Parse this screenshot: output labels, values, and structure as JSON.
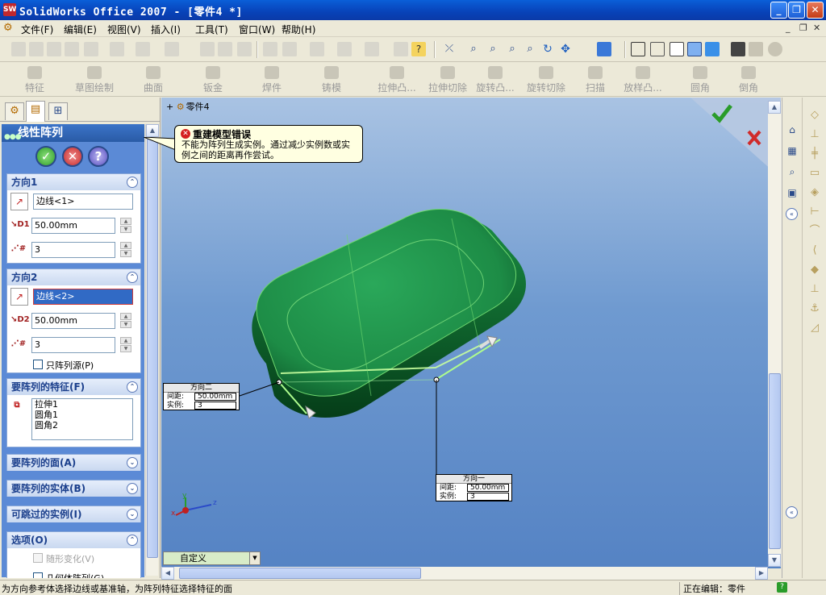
{
  "window": {
    "title": "SolidWorks Office 2007 - [零件4 *]",
    "app_icon": "solidworks-logo",
    "buttons": {
      "minimize": "_",
      "restore": "❐",
      "close": "✕"
    }
  },
  "menu": {
    "items": [
      "文件(F)",
      "编辑(E)",
      "视图(V)",
      "插入(I)",
      "工具(T)",
      "窗口(W)",
      "帮助(H)"
    ],
    "doc_controls": [
      "_",
      "❐",
      "✕"
    ]
  },
  "features_toolbar": {
    "items": [
      "特征",
      "草图绘制",
      "曲面",
      "钣金",
      "焊件",
      "铸模",
      "拉伸凸...",
      "拉伸切除",
      "旋转凸...",
      "旋转切除",
      "扫描",
      "放样凸...",
      "圆角",
      "倒角"
    ]
  },
  "property_manager": {
    "title": "线性阵列",
    "direction1": {
      "label": "方向1",
      "edge": "边线<1>",
      "spacing": "50.00mm",
      "instances": "3"
    },
    "direction2": {
      "label": "方向2",
      "edge": "边线<2>",
      "spacing": "50.00mm",
      "instances": "3",
      "pattern_seed_only": "只阵列源(P)"
    },
    "features_to_pattern": {
      "label": "要阵列的特征(F)",
      "items": [
        "拉伸1",
        "圆角1",
        "圆角2"
      ]
    },
    "faces_to_pattern": "要阵列的面(A)",
    "bodies_to_pattern": "要阵列的实体(B)",
    "instances_to_skip": "可跳过的实例(I)",
    "options": {
      "label": "选项(O)",
      "vary_sketch": "随形变化(V)",
      "geometry_pattern": "几何体阵列(G)"
    }
  },
  "tooltip": {
    "title": "重建模型错误",
    "message": "不能为阵列生成实例。通过减少实例数或实例之间的距离再作尝试。"
  },
  "viewport": {
    "tree_node": "零件4",
    "callout_dir2": {
      "title": "方向二",
      "spacing_label": "间距:",
      "spacing": "50.00mm",
      "instances_label": "实例:",
      "instances": "3"
    },
    "callout_dir1": {
      "title": "方向一",
      "spacing_label": "间距:",
      "spacing": "50.00mm",
      "instances_label": "实例:",
      "instances": "3"
    },
    "view_dropdown": "自定义",
    "model_color": "#1f8f46",
    "background_top": "#a9c3e3",
    "background_bottom": "#5583c4",
    "triad_labels": {
      "x": "x",
      "y": "y",
      "z": "z"
    }
  },
  "status": {
    "message": "为方向参考体选择边线或基准轴，为阵列特征选择特征的面",
    "state": "正在编辑：零件"
  }
}
